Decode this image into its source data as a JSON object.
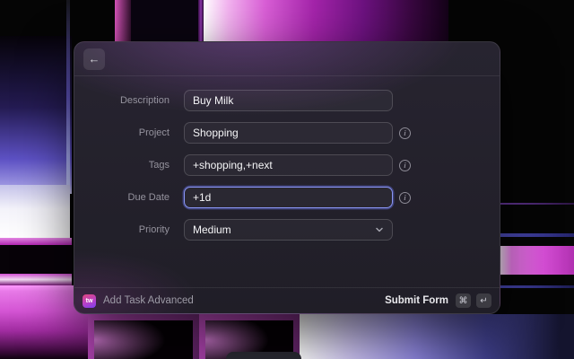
{
  "header": {
    "back_icon": "←"
  },
  "form": {
    "fields": [
      {
        "label": "Description",
        "value": "Buy Milk"
      },
      {
        "label": "Project",
        "value": "Shopping"
      },
      {
        "label": "Tags",
        "value": "+shopping,+next"
      },
      {
        "label": "Due Date",
        "value": "+1d"
      },
      {
        "label": "Priority",
        "value": "Medium"
      }
    ],
    "info_icon_glyph": "i"
  },
  "footer": {
    "app_icon_text": "tw",
    "app_name": "Add Task Advanced",
    "submit_label": "Submit Form",
    "key_command": "⌘",
    "key_return": "↵"
  },
  "colors": {
    "focus_ring": "#8a96f5",
    "accent_magenta": "#d84fd8",
    "app_icon_top": "#e0487e",
    "app_icon_bottom": "#7a3ff0"
  }
}
